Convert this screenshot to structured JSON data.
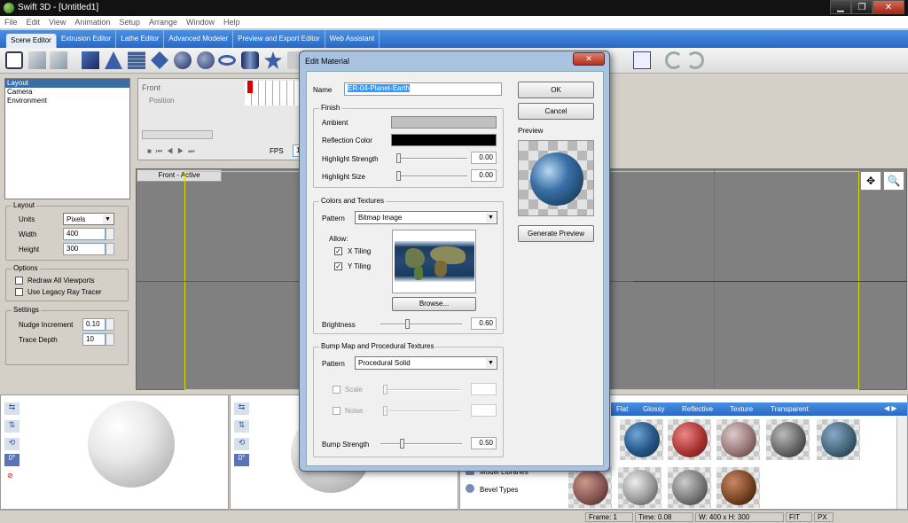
{
  "app": {
    "title": "Swift 3D - [Untitled1]"
  },
  "menu": [
    "File",
    "Edit",
    "View",
    "Animation",
    "Setup",
    "Arrange",
    "Window",
    "Help"
  ],
  "tabs": [
    "Scene Editor",
    "Extrusion Editor",
    "Lathe Editor",
    "Advanced Modeler",
    "Preview and Export Editor",
    "Web Assistant"
  ],
  "scene_list": [
    "Layout",
    "Camera",
    "Environment"
  ],
  "layout": {
    "title": "Layout",
    "units_label": "Units",
    "units_value": "Pixels",
    "width_label": "Width",
    "width_value": "400",
    "height_label": "Height",
    "height_value": "300"
  },
  "options": {
    "title": "Options",
    "redraw": "Redraw All Viewports",
    "legacy": "Use Legacy Ray Tracer"
  },
  "settings": {
    "title": "Settings",
    "nudge_label": "Nudge Increment",
    "nudge_value": "0.10",
    "trace_label": "Trace Depth",
    "trace_value": "10"
  },
  "timeline": {
    "front": "Front",
    "position": "Position",
    "fps_label": "FPS",
    "fps_value": "12"
  },
  "viewport": {
    "label": "Front - Active"
  },
  "rotation": {
    "deg1": "0°",
    "deg2": "0°"
  },
  "dialog": {
    "title": "Edit Material",
    "name_label": "Name",
    "name_value": "ER-04-Planet-Earth",
    "ok": "OK",
    "cancel": "Cancel",
    "preview_label": "Preview",
    "generate": "Generate Preview",
    "finish": {
      "title": "Finish",
      "ambient": "Ambient",
      "reflection": "Reflection Color",
      "hs_label": "Highlight Strength",
      "hs_value": "0.00",
      "hsize_label": "Highlight Size",
      "hsize_value": "0.00"
    },
    "colors": {
      "title": "Colors and Textures",
      "pattern_label": "Pattern",
      "pattern_value": "Bitmap Image",
      "allow": "Allow:",
      "xtiling": "X Tiling",
      "ytiling": "Y Tiling",
      "browse": "Browse...",
      "brightness_label": "Brightness",
      "brightness_value": "0.60"
    },
    "bump": {
      "title": "Bump Map and Procedural Textures",
      "pattern_label": "Pattern",
      "pattern_value": "Procedural Solid",
      "scale": "Scale",
      "noise": "Noise",
      "strength_label": "Bump Strength",
      "strength_value": "0.50"
    },
    "colors_hex": {
      "ambient": "#c0c0c0",
      "reflection": "#000000"
    }
  },
  "gallery": {
    "tabs": [
      "Flat",
      "Glossy",
      "Reflective",
      "Texture",
      "Transparent"
    ],
    "items": [
      "Model Libraries",
      "Bevel Types"
    ]
  },
  "status": {
    "frame": "Frame: 1",
    "time": "Time: 0.08",
    "size": "W: 400 x H: 300",
    "fit": "FIT",
    "px": "PX"
  }
}
